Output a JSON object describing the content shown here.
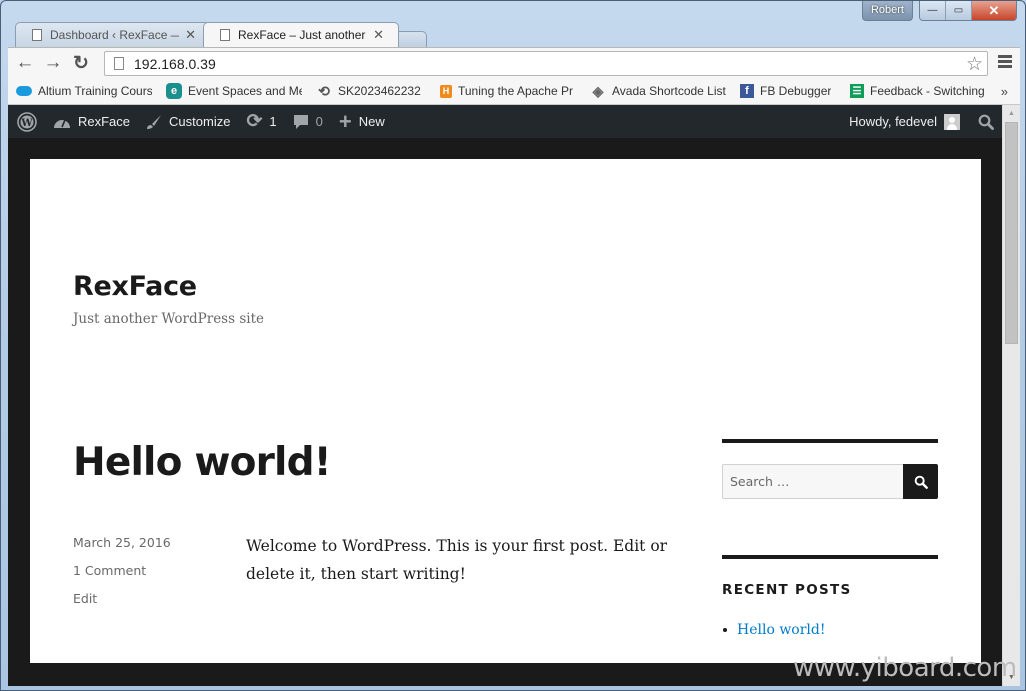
{
  "window": {
    "user_label": "Robert",
    "minimize_glyph": "—",
    "maximize_glyph": "▭",
    "close_glyph": "✕"
  },
  "tabs": [
    {
      "label": "Dashboard ‹ RexFace — W",
      "active": false,
      "icon": "document-icon"
    },
    {
      "label": "RexFace – Just another Wo",
      "active": true,
      "icon": "document-icon"
    }
  ],
  "toolbar": {
    "back_glyph": "←",
    "forward_glyph": "→",
    "reload_glyph": "↻",
    "url": "192.168.0.39",
    "star_glyph": "☆"
  },
  "bookmarks": [
    {
      "label": "Altium Training Cours",
      "icon": "cloud-icon",
      "color": "#1a9be0"
    },
    {
      "label": "Event Spaces and Me",
      "icon": "e-logo-icon",
      "color": "#1b8e8e"
    },
    {
      "label": "SK2023462232",
      "icon": "history-icon",
      "color": "#555555"
    },
    {
      "label": "Tuning the Apache Pr",
      "icon": "h-logo-icon",
      "color": "#f08a1d"
    },
    {
      "label": "Avada Shortcode List",
      "icon": "layers-icon",
      "color": "#666666"
    },
    {
      "label": "FB Debugger",
      "icon": "facebook-icon",
      "color": "#3b5998"
    },
    {
      "label": "Feedback - Switching",
      "icon": "sheets-icon",
      "color": "#0f9d58"
    }
  ],
  "bookmarks_more": "»",
  "adminbar": {
    "site_name": "RexFace",
    "customize": "Customize",
    "updates_count": "1",
    "comments_count": "0",
    "new_label": "New",
    "howdy": "Howdy, fedevel"
  },
  "site": {
    "title": "RexFace",
    "description": "Just another WordPress site"
  },
  "post": {
    "title": "Hello world!",
    "date": "March 25, 2016",
    "comments": "1 Comment",
    "edit": "Edit",
    "body": "Welcome to WordPress. This is your first post. Edit or delete it, then start writing!"
  },
  "sidebar": {
    "search_placeholder": "Search …",
    "recent_posts_title": "RECENT POSTS",
    "recent_posts": [
      "Hello world!"
    ]
  },
  "watermark": "www.yiboard.com"
}
